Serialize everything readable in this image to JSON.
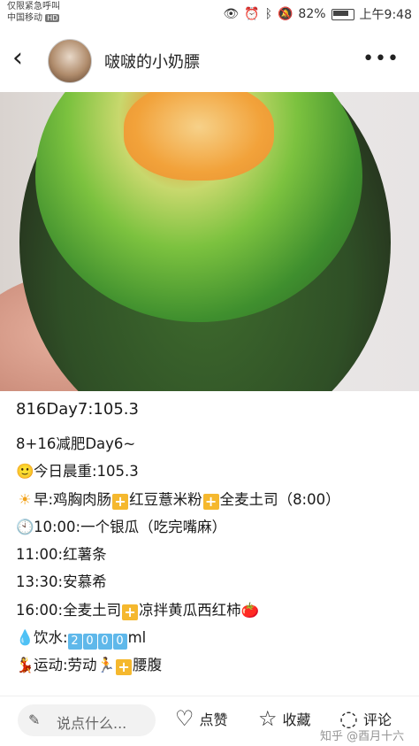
{
  "status_bar": {
    "carrier_line1": "仅限紧急呼叫",
    "carrier_line2": "中国移动",
    "carrier_badge": "HD",
    "battery": "82%",
    "time": "上午9:48"
  },
  "header": {
    "author_name": "啵啵的小奶膘",
    "back_icon": "chevron-left-icon",
    "more_icon": "more-dots-icon"
  },
  "post": {
    "title": "816Day7:105.3",
    "lines": [
      {
        "emoji": "",
        "text": "8+16减肥Day6~"
      },
      {
        "emoji": "🙂",
        "text": "今日晨重:105.3"
      },
      {
        "emoji": "☀",
        "parts": [
          "早:鸡胸肉肠",
          "红豆薏米粉",
          "全麦土司（8:00）"
        ]
      },
      {
        "emoji": "🕙",
        "text": "10:00:一个银瓜（吃完嘴麻）"
      },
      {
        "emoji": "",
        "text": "11:00:红薯条"
      },
      {
        "emoji": "",
        "text": "13:30:安慕希"
      },
      {
        "emoji": "",
        "parts": [
          "16:00:全麦土司",
          "凉拌黄瓜西红柿🍅"
        ]
      },
      {
        "emoji": "💧",
        "prefix": "饮水:",
        "digits": [
          "2",
          "0",
          "0",
          "0"
        ],
        "suffix": "ml"
      },
      {
        "emoji": "💃",
        "parts": [
          "运动:劳动🏃",
          "腰腹"
        ]
      }
    ]
  },
  "bottom_bar": {
    "comment_placeholder": "说点什么...",
    "like_label": "点赞",
    "favorite_label": "收藏",
    "comment_label": "评论",
    "watermark": "知乎 @酉月十六"
  }
}
